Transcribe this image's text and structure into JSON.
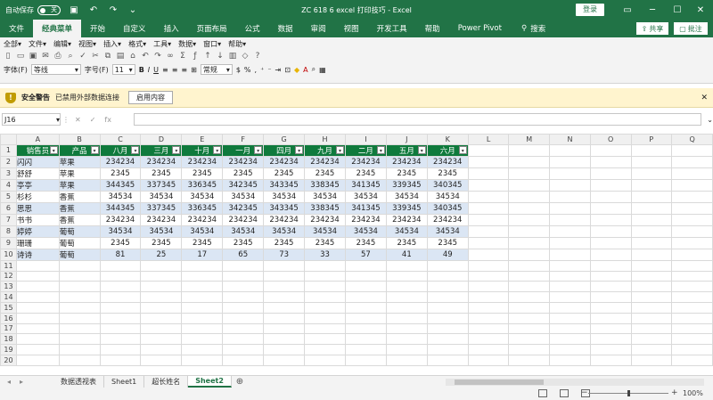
{
  "titlebar": {
    "autosave_label": "自动保存",
    "autosave_state": "关",
    "title": "ZC 618 6 excel 打印技巧 - Excel",
    "login_label": "登录"
  },
  "tabs": [
    "文件",
    "经典菜单",
    "开始",
    "自定义",
    "插入",
    "页面布局",
    "公式",
    "数据",
    "审阅",
    "视图",
    "开发工具",
    "帮助",
    "Power Pivot"
  ],
  "active_tab": "经典菜单",
  "search_label": "搜索",
  "share_label": "共享",
  "comment_label": "批注",
  "classic_menu": [
    "全部▾",
    "文件▾",
    "编辑▾",
    "视图▾",
    "插入▾",
    "格式▾",
    "工具▾",
    "数据▾",
    "窗口▾",
    "帮助▾"
  ],
  "font_row": {
    "font_label": "字体(F)",
    "font_value": "等线",
    "size_label": "字号(F)",
    "size_value": "11",
    "format_value": "常规"
  },
  "security": {
    "title": "安全警告",
    "message": "已禁用外部数据连接",
    "button": "启用内容",
    "close": "✕"
  },
  "formula_bar": {
    "namebox": "J16",
    "fx": "fx"
  },
  "columns": [
    "A",
    "B",
    "C",
    "D",
    "E",
    "F",
    "G",
    "H",
    "I",
    "J",
    "K",
    "L",
    "M",
    "N",
    "O",
    "P",
    "Q"
  ],
  "table": {
    "headers": [
      "销售员",
      "产品",
      "八月",
      "三月",
      "十月",
      "一月",
      "四月",
      "九月",
      "二月",
      "五月",
      "六月"
    ],
    "rows": [
      [
        "闪闪",
        "苹果",
        "234234",
        "234234",
        "234234",
        "234234",
        "234234",
        "234234",
        "234234",
        "234234",
        "234234"
      ],
      [
        "舒舒",
        "苹果",
        "2345",
        "2345",
        "2345",
        "2345",
        "2345",
        "2345",
        "2345",
        "2345",
        "2345"
      ],
      [
        "亭亭",
        "苹果",
        "344345",
        "337345",
        "336345",
        "342345",
        "343345",
        "338345",
        "341345",
        "339345",
        "340345"
      ],
      [
        "杉杉",
        "香蕉",
        "34534",
        "34534",
        "34534",
        "34534",
        "34534",
        "34534",
        "34534",
        "34534",
        "34534"
      ],
      [
        "思思",
        "香蕉",
        "344345",
        "337345",
        "336345",
        "342345",
        "343345",
        "338345",
        "341345",
        "339345",
        "340345"
      ],
      [
        "书书",
        "香蕉",
        "234234",
        "234234",
        "234234",
        "234234",
        "234234",
        "234234",
        "234234",
        "234234",
        "234234"
      ],
      [
        "婷婷",
        "葡萄",
        "34534",
        "34534",
        "34534",
        "34534",
        "34534",
        "34534",
        "34534",
        "34534",
        "34534"
      ],
      [
        "珊珊",
        "葡萄",
        "2345",
        "2345",
        "2345",
        "2345",
        "2345",
        "2345",
        "2345",
        "2345",
        "2345"
      ],
      [
        "诗诗",
        "葡萄",
        "81",
        "25",
        "17",
        "65",
        "73",
        "33",
        "57",
        "41",
        "49"
      ]
    ]
  },
  "row_count": 20,
  "sheets": [
    "数据透视表",
    "Sheet1",
    "超长姓名",
    "Sheet2"
  ],
  "active_sheet": "Sheet2",
  "zoom": "100%",
  "colors": {
    "excel_green": "#217346",
    "header_green": "#0f7a3c",
    "band_blue": "#dbe6f4",
    "warning_bg": "#fff4ce"
  }
}
